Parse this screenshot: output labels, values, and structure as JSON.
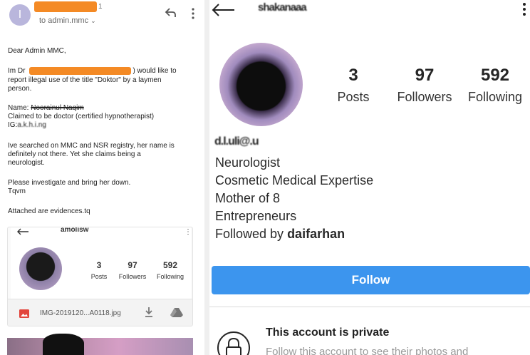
{
  "email": {
    "sender_avatar_letter": "I",
    "sender_suffix": "1",
    "to_line": "to admin.mmc",
    "greeting": "Dear Admin MMC,",
    "intro_prefix": "Im Dr",
    "intro_suffix": ") would like to",
    "intro_line2": "report illegal use of the title \"Doktor\" by a laymen",
    "intro_line3": "person.",
    "name_label": "Name:",
    "name_value": "Noorainul Naqim",
    "claim_line": "Claimed to be doctor (certified hypnotherapist)",
    "ig_label": "IG:",
    "ig_value": "a.k.h.i.ng",
    "searched_line1": "Ive searched on MMC and NSR registry, her name is",
    "searched_line2": "definitely not there. Yet she claims being a",
    "searched_line3": "neurologist.",
    "investigate_line": "Please investigate and bring her down.",
    "signoff": "Tqvm",
    "attached_line": "Attached are evidences.tq",
    "attachment": {
      "mini_username": "amolisw",
      "stats": [
        {
          "value": "3",
          "label": "Posts"
        },
        {
          "value": "97",
          "label": "Followers"
        },
        {
          "value": "592",
          "label": "Following"
        }
      ],
      "file_name": "IMG-2019120...A0118.jpg"
    }
  },
  "instagram": {
    "username": "shakanaaa",
    "stats": [
      {
        "value": "3",
        "label": "Posts"
      },
      {
        "value": "97",
        "label": "Followers"
      },
      {
        "value": "592",
        "label": "Following"
      }
    ],
    "display_name": "d.l.uli@.u",
    "bio_lines": [
      "Neurologist",
      "Cosmetic Medical Expertise",
      "Mother of 8",
      "Entrepreneurs"
    ],
    "followed_by_prefix": "Followed by ",
    "followed_by_user": "daifarhan",
    "follow_button": "Follow",
    "private_title": "This account is private",
    "private_subtitle": "Follow this account to see their photos and"
  },
  "colors": {
    "redaction": "#f48a25",
    "follow_button": "#3c95ee",
    "sender_avatar": "#b9b6dc"
  }
}
